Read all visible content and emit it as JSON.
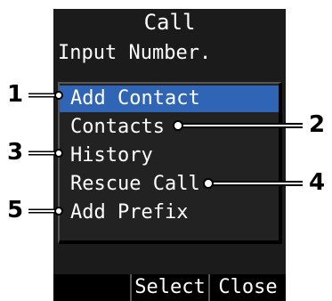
{
  "header": {
    "title": "Call"
  },
  "prompt": "Input Number.",
  "menu": {
    "items": [
      {
        "label": "Add Contact",
        "selected": true
      },
      {
        "label": "Contacts",
        "selected": false
      },
      {
        "label": "History",
        "selected": false
      },
      {
        "label": "Rescue Call",
        "selected": false
      },
      {
        "label": "Add Prefix",
        "selected": false
      }
    ]
  },
  "softkeys": {
    "left": "",
    "middle": "Select",
    "right": "Close"
  },
  "callouts": [
    "1",
    "2",
    "3",
    "4",
    "5"
  ],
  "colors": {
    "screen_bg": "#1b1b1b",
    "selection": "#2f65b4",
    "text": "#ffffff"
  }
}
